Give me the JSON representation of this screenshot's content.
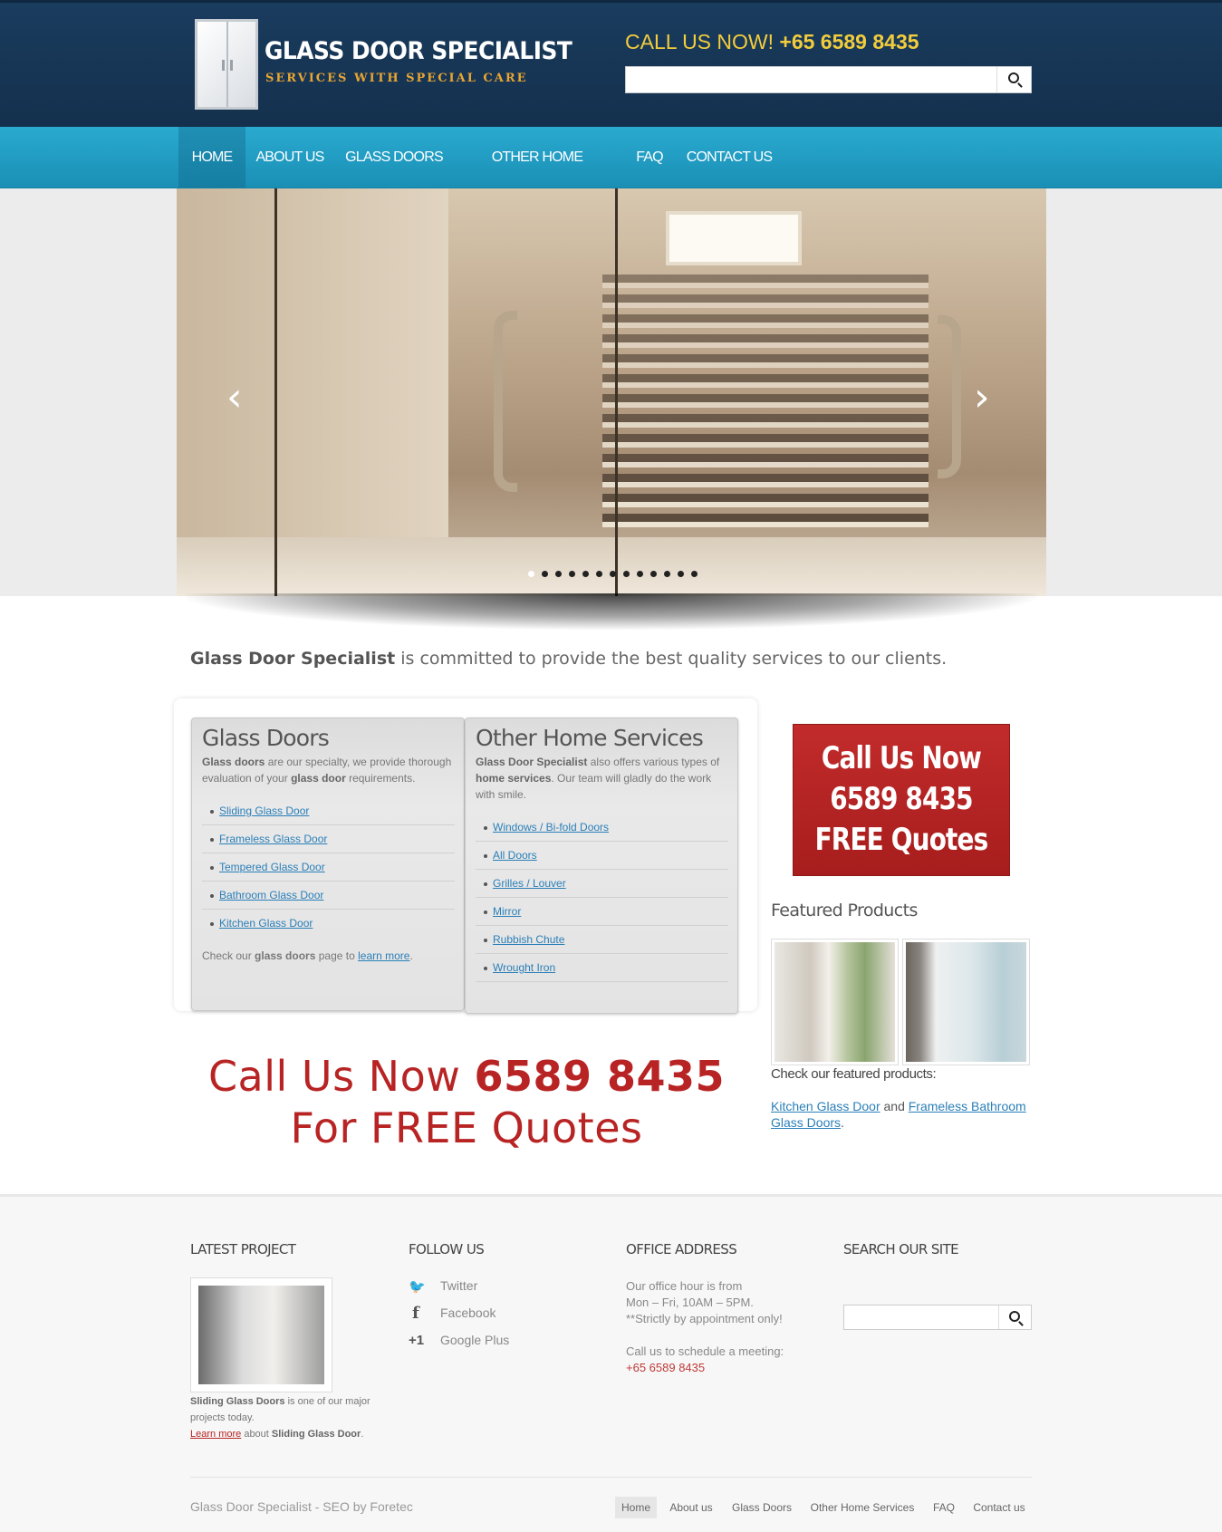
{
  "header": {
    "logo_title": "GLASS DOOR SPECIALIST",
    "logo_subtitle": "SERVICES WITH SPECIAL CARE",
    "call_label": "CALL US NOW!",
    "call_number": "+65 6589 8435",
    "search_placeholder": ""
  },
  "nav": {
    "items": [
      {
        "label": "HOME",
        "active": true
      },
      {
        "label": "ABOUT US"
      },
      {
        "label": "GLASS DOORS"
      },
      {
        "label": "OTHER HOME SERVICES"
      },
      {
        "label": "FAQ"
      },
      {
        "label": "CONTACT US"
      }
    ]
  },
  "slider": {
    "prev_arrow": "‹",
    "next_arrow": "›",
    "slide_count": 13,
    "active_slide": 1
  },
  "tagline": {
    "brand": "Glass Door Specialist",
    "text": " is committed to provide the best quality services to our clients."
  },
  "glass_doors": {
    "title": "Glass Doors",
    "desc_b1": "Glass doors",
    "desc_t1": " are our specialty, we provide thorough evaluation of your ",
    "desc_b2": "glass door",
    "desc_t2": " requirements.",
    "links": [
      "Sliding Glass Door",
      "Frameless Glass Door",
      "Tempered Glass Door",
      "Bathroom Glass Door",
      "Kitchen Glass Door"
    ],
    "more_t1": "Check our ",
    "more_b": "glass doors",
    "more_t2": " page to ",
    "more_link": "learn more",
    "more_t3": "."
  },
  "other_services": {
    "title": "Other Home Services",
    "desc_b1": "Glass Door Specialist",
    "desc_t1": " also offers various types of ",
    "desc_b2": "home services",
    "desc_t2": ". Our team will gladly do the work with smile.",
    "links": [
      "Windows / Bi-fold Doors",
      "All Doors",
      "Grilles / Louver",
      "Mirror",
      "Rubbish Chute",
      "Wrought Iron"
    ]
  },
  "big_cta": {
    "line1_text": "Call Us Now ",
    "line1_number": "6589 8435",
    "line2": "For FREE Quotes"
  },
  "red_cta": {
    "line1": "Call Us Now",
    "line2": "6589 8435",
    "line3": "FREE Quotes"
  },
  "featured": {
    "title": "Featured Products",
    "text": "Check our featured products:",
    "link1": "Kitchen Glass Door",
    "and": " and ",
    "link2": "Frameless Bathroom Glass Doors",
    "end": "."
  },
  "footer": {
    "latest_project": {
      "title": "LATEST PROJECT",
      "desc_b": "Sliding Glass Doors",
      "desc_t": " is one of our major projects today.",
      "link": "Learn more",
      "about_t": " about ",
      "about_b": "Sliding Glass Door",
      "end": "."
    },
    "follow": {
      "title": "FOLLOW US",
      "items": [
        {
          "icon": "twitter-icon",
          "glyph": "🐦",
          "label": "Twitter"
        },
        {
          "icon": "facebook-icon",
          "glyph": "f",
          "label": "Facebook"
        },
        {
          "icon": "google-plus-icon",
          "glyph": "+1",
          "label": "Google Plus"
        }
      ]
    },
    "office": {
      "title": "OFFICE ADDRESS",
      "line1": "Our office hour is from",
      "line2": "Mon – Fri, 10AM – 5PM.",
      "line3": "**Strictly by appointment only!",
      "line4": "Call us to schedule a meeting:",
      "phone": "+65 6589 8435"
    },
    "search": {
      "title": "SEARCH OUR SITE"
    },
    "copyright": "Glass Door Specialist - SEO by Foretec",
    "nav": [
      "Home",
      "About us",
      "Glass Doors",
      "Other Home Services",
      "FAQ",
      "Contact us"
    ]
  }
}
